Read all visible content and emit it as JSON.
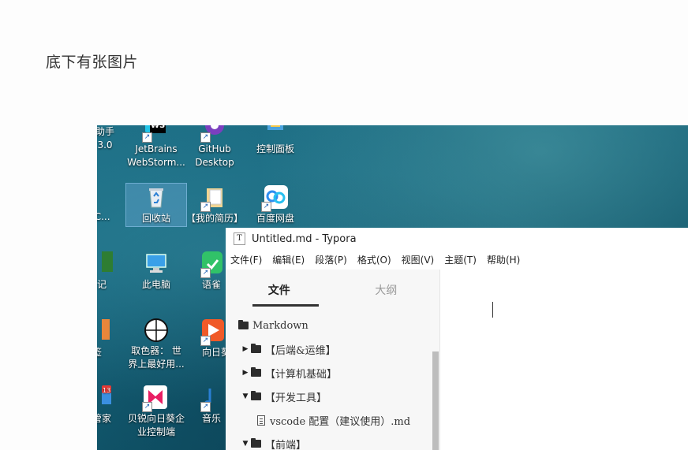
{
  "doc": {
    "caption": "底下有张图片"
  },
  "desktop": {
    "icons": {
      "assistant": {
        "label_line1": "助手",
        "label_line2": "3.0",
        "icon": "app-icon"
      },
      "webstorm": {
        "label_line1": "JetBrains",
        "label_line2": "WebStorm...",
        "icon": "webstorm-icon"
      },
      "github": {
        "label_line1": "GitHub",
        "label_line2": "Desktop",
        "icon": "github-desktop-icon"
      },
      "control_panel": {
        "label_line1": "控制面板",
        "icon": "control-panel-icon"
      },
      "partial_nc": {
        "label_line1": "N-C...",
        "icon": "app-icon"
      },
      "recycle_bin": {
        "label_line1": "回收站",
        "icon": "recycle-bin-icon"
      },
      "resume": {
        "label_line1": "【我的简历】",
        "icon": "folder-icon"
      },
      "baidu_pan": {
        "label_line1": "百度网盘",
        "icon": "baidu-netdisk-icon"
      },
      "notes": {
        "label_line1": "笔记",
        "icon": "notes-icon"
      },
      "this_pc": {
        "label_line1": "此电脑",
        "icon": "computer-icon"
      },
      "yuque": {
        "label_line1": "语雀",
        "icon": "yuque-icon"
      },
      "partial_qian": {
        "label_line1": "签",
        "icon": "app-icon"
      },
      "color_picker": {
        "label_line1": "取色器： 世",
        "label_line2": "界上最好用...",
        "icon": "crosshair-icon"
      },
      "sunlogin": {
        "label_line1": "向日葵",
        "icon": "sunlogin-icon"
      },
      "pc_manager": {
        "label_line1": "件管家",
        "badge": "13",
        "icon": "pc-manager-icon"
      },
      "sunlogin_enterprise": {
        "label_line1": "贝锐向日葵企",
        "label_line2": "业控制端",
        "icon": "sunlogin-enterprise-icon"
      },
      "music": {
        "label_line1": "音乐",
        "icon": "music-icon"
      }
    }
  },
  "typora": {
    "title": "Untitled.md - Typora",
    "menu": [
      "文件(F)",
      "编辑(E)",
      "段落(P)",
      "格式(O)",
      "视图(V)",
      "主题(T)",
      "帮助(H)"
    ],
    "sidebar": {
      "tabs": [
        "文件",
        "大纲"
      ],
      "active_tab": "文件",
      "tree": [
        {
          "name": "Markdown",
          "type": "folder",
          "state": "root"
        },
        {
          "name": "【后端&运维】",
          "type": "folder",
          "state": "collapsed"
        },
        {
          "name": "【计算机基础】",
          "type": "folder",
          "state": "collapsed"
        },
        {
          "name": "【开发工具】",
          "type": "folder",
          "state": "expanded"
        },
        {
          "name": "vscode 配置（建议使用）.md",
          "type": "file"
        },
        {
          "name": "【前端】",
          "type": "folder",
          "state": "expanded"
        }
      ]
    }
  }
}
